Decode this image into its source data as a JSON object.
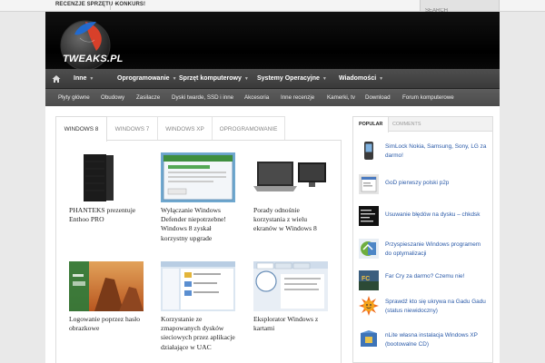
{
  "topbar": {
    "links": [
      {
        "label": "Recenzje sprzętu",
        "has_dropdown": true
      },
      {
        "label": "Konkurs!",
        "has_dropdown": false
      }
    ],
    "search_placeholder": "SEARCH"
  },
  "header": {
    "logo_text": "TWEAKS.PL"
  },
  "main_nav": {
    "items": [
      {
        "label": "Inne"
      },
      {
        "label": "Oprogramowanie"
      },
      {
        "label": "Sprzęt komputerowy"
      },
      {
        "label": "Systemy Operacyjne"
      },
      {
        "label": "Wiadomości"
      }
    ]
  },
  "sub_nav": {
    "items": [
      {
        "label": "Płyty główne"
      },
      {
        "label": "Obudowy"
      },
      {
        "label": "Zasilacze"
      },
      {
        "label": "Dyski twarde, SSD i inne"
      },
      {
        "label": "Akcesoria"
      },
      {
        "label": "Inne recenzje"
      },
      {
        "label": "Kamerki, tv"
      },
      {
        "label": "Download"
      },
      {
        "label": "Forum komputerowe"
      }
    ]
  },
  "content_tabs": {
    "active_index": 0,
    "items": [
      {
        "label": "WINDOWS 8"
      },
      {
        "label": "WINDOWS 7"
      },
      {
        "label": "WINDOWS XP"
      },
      {
        "label": "OPROGRAMOWANIE"
      }
    ]
  },
  "posts": [
    {
      "title": "PHANTEKS prezentuje Enthoo PRO"
    },
    {
      "title": "Wyłączanie Windows Defender niepotrzebne! Windows 8 zyskał korzystny upgrade"
    },
    {
      "title": "Porady odnośnie korzystania z wielu ekranów w Windows 8"
    },
    {
      "title": "Logowanie poprzez hasło obrazkowe"
    },
    {
      "title": "Korzystanie ze zmapowanych dysków sieciowych przez aplikacje działające w UAC"
    },
    {
      "title": "Eksplorator Windows z kartami"
    }
  ],
  "sidebar": {
    "tabs": [
      {
        "label": "POPULAR"
      },
      {
        "label": "COMMENTS"
      }
    ],
    "active_tab": 0,
    "items": [
      {
        "text": "SimLock Nokia, Samsung, Sony, LG za darmo!"
      },
      {
        "text": "GoD pierwszy polski p2p"
      },
      {
        "text": "Usuwanie błędów na dysku – chkdsk"
      },
      {
        "text": "Przyspieszanie Windows programem do optymalizacji"
      },
      {
        "text": "Far Cry za darmo? Czemu nie!"
      },
      {
        "text": "Sprawdź kto się ukrywa na Gadu Gadu (status niewidoczny)"
      },
      {
        "text": "nLite własna instalacja Windows XP (bootowalne CD)"
      }
    ]
  },
  "colors": {
    "link_blue": "#2a5aa8",
    "nav_bg": "#444444",
    "subnav_bg": "#555555",
    "header_bg": "#000000"
  }
}
